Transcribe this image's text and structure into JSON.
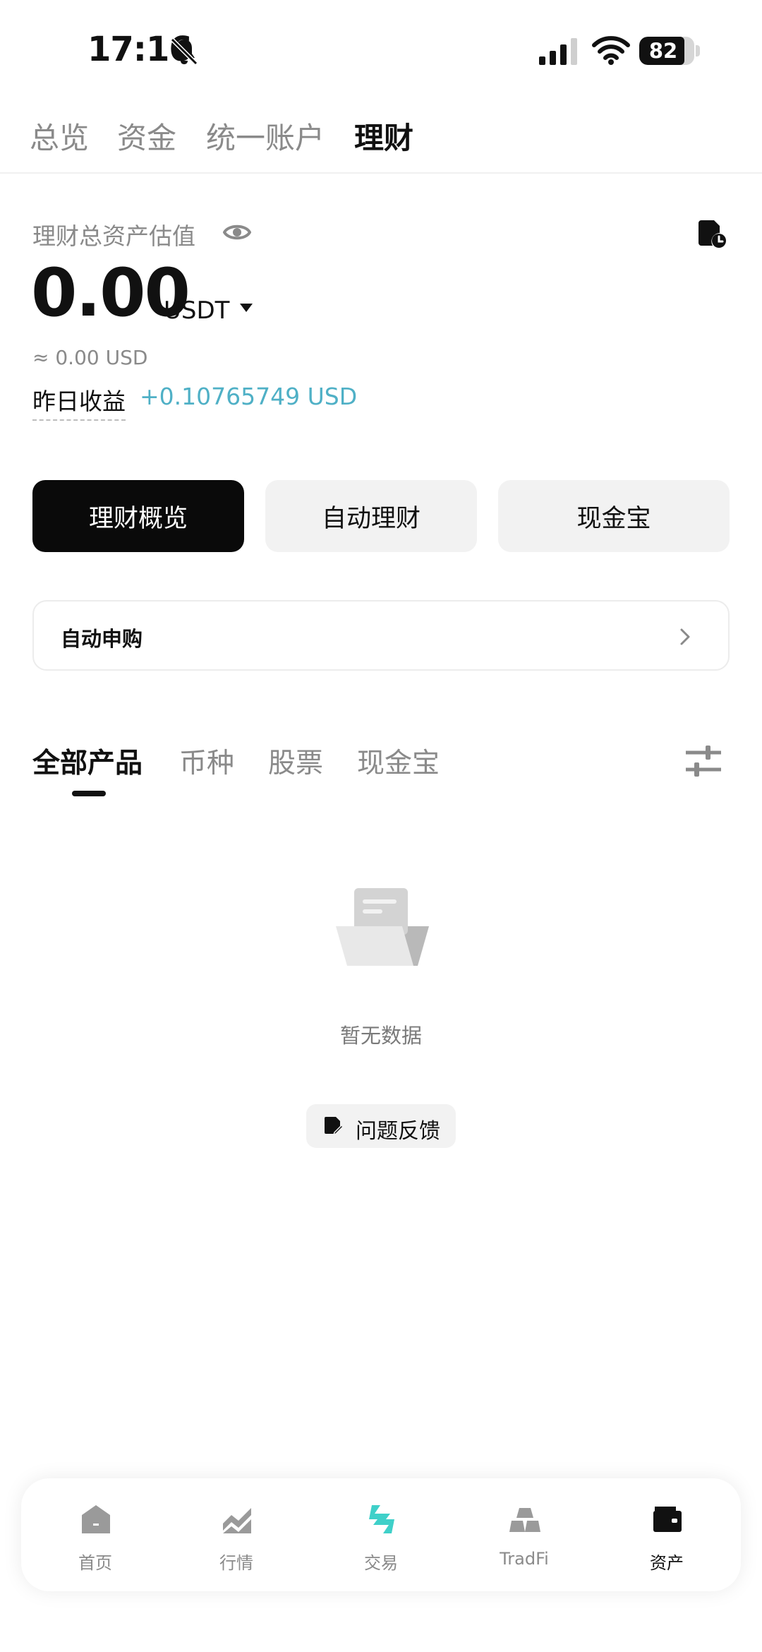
{
  "status_bar": {
    "time": "17:16",
    "battery": "82",
    "battery_level": 0.82
  },
  "top_tabs": [
    {
      "label": "总览"
    },
    {
      "label": "资金"
    },
    {
      "label": "统一账户"
    },
    {
      "label": "理财",
      "active": true
    }
  ],
  "asset": {
    "label": "理财总资产估值",
    "value": "0.00",
    "unit": "USDT",
    "usd_approx": "≈ 0.00 USD",
    "yesterday_label": "昨日收益",
    "yesterday_value": "+0.10765749 USD"
  },
  "segments": [
    {
      "label": "理财概览",
      "active": true
    },
    {
      "label": "自动理财"
    },
    {
      "label": "现金宝"
    }
  ],
  "auto_subscribe": {
    "label": "自动申购"
  },
  "product_tabs": [
    {
      "label": "全部产品",
      "active": true
    },
    {
      "label": "币种"
    },
    {
      "label": "股票"
    },
    {
      "label": "现金宝"
    }
  ],
  "empty": {
    "text": "暂无数据",
    "feedback_label": "问题反馈"
  },
  "bottom_nav": [
    {
      "label": "首页",
      "icon": "home-icon"
    },
    {
      "label": "行情",
      "icon": "market-chart-icon"
    },
    {
      "label": "交易",
      "icon": "trade-exchange-icon"
    },
    {
      "label": "TradFi",
      "icon": "gold-bars-icon"
    },
    {
      "label": "资产",
      "icon": "wallet-icon",
      "active": true
    }
  ],
  "colors": {
    "accent_teal": "#4fb0c6",
    "trade_icon": "#3fd0c9",
    "active_button": "#0a0a0a",
    "inactive_button": "#f2f2f2"
  }
}
